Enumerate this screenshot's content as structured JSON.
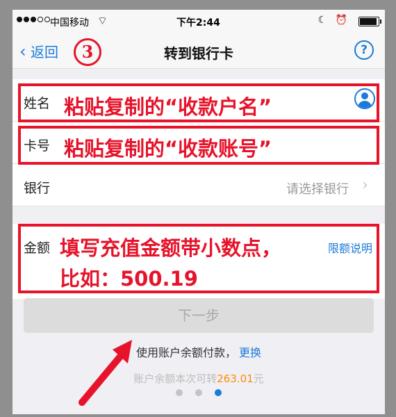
{
  "status": {
    "carrier": "中国移动",
    "time": "下午2:44"
  },
  "nav": {
    "back": "返回",
    "step": "3",
    "title": "转到银行卡",
    "help": "?"
  },
  "form": {
    "name_label": "姓名",
    "card_label": "卡号",
    "bank_label": "银行",
    "bank_hint": "请选择银行",
    "amount_label": "金额",
    "limit_link": "限额说明"
  },
  "annotations": {
    "name": "粘贴复制的“收款户名”",
    "card": "粘贴复制的“收款账号”",
    "amount_line1": "填写充值金额带小数点，",
    "amount_line2": "比如：500.19"
  },
  "next_button": "下一步",
  "pay_info": {
    "text": "使用账户余额付款，",
    "link": "更换"
  },
  "balance": {
    "prefix": "账户余额本次可转",
    "amount": "263.01",
    "suffix": "元"
  },
  "pager": {
    "pages": 3,
    "active": 3
  },
  "colors": {
    "accent": "#1a7bd8",
    "annotation": "#e6132a",
    "balance": "#ff8a00"
  }
}
